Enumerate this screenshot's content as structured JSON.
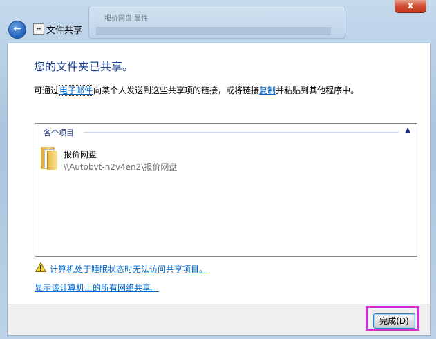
{
  "window": {
    "title": "文件共享",
    "close_glyph": "x",
    "background_window_title": "报价网盘 属性"
  },
  "main": {
    "heading": "您的文件夹已共享。",
    "description": {
      "part1": "可通过",
      "email_link": "电子邮件",
      "part2": "向某个人发送到这些共享项的链接，或将链接",
      "copy_link": "复制",
      "part3": "并粘贴到其他程序中。"
    },
    "list": {
      "group_header": "各个项目",
      "items": [
        {
          "name": "报价网盘",
          "path": "\\\\Autobvt-n2v4en2\\报价网盘",
          "icon": "folder-icon"
        }
      ]
    },
    "warning_link": "计算机处于睡眠状态时无法访问共享项目。",
    "show_all_link": "显示该计算机上的所有网络共享。"
  },
  "footer": {
    "finish_button": "完成(D)"
  },
  "colors": {
    "heading": "#1c3f94",
    "link": "#0066cc",
    "highlight": "#d42fd4"
  }
}
